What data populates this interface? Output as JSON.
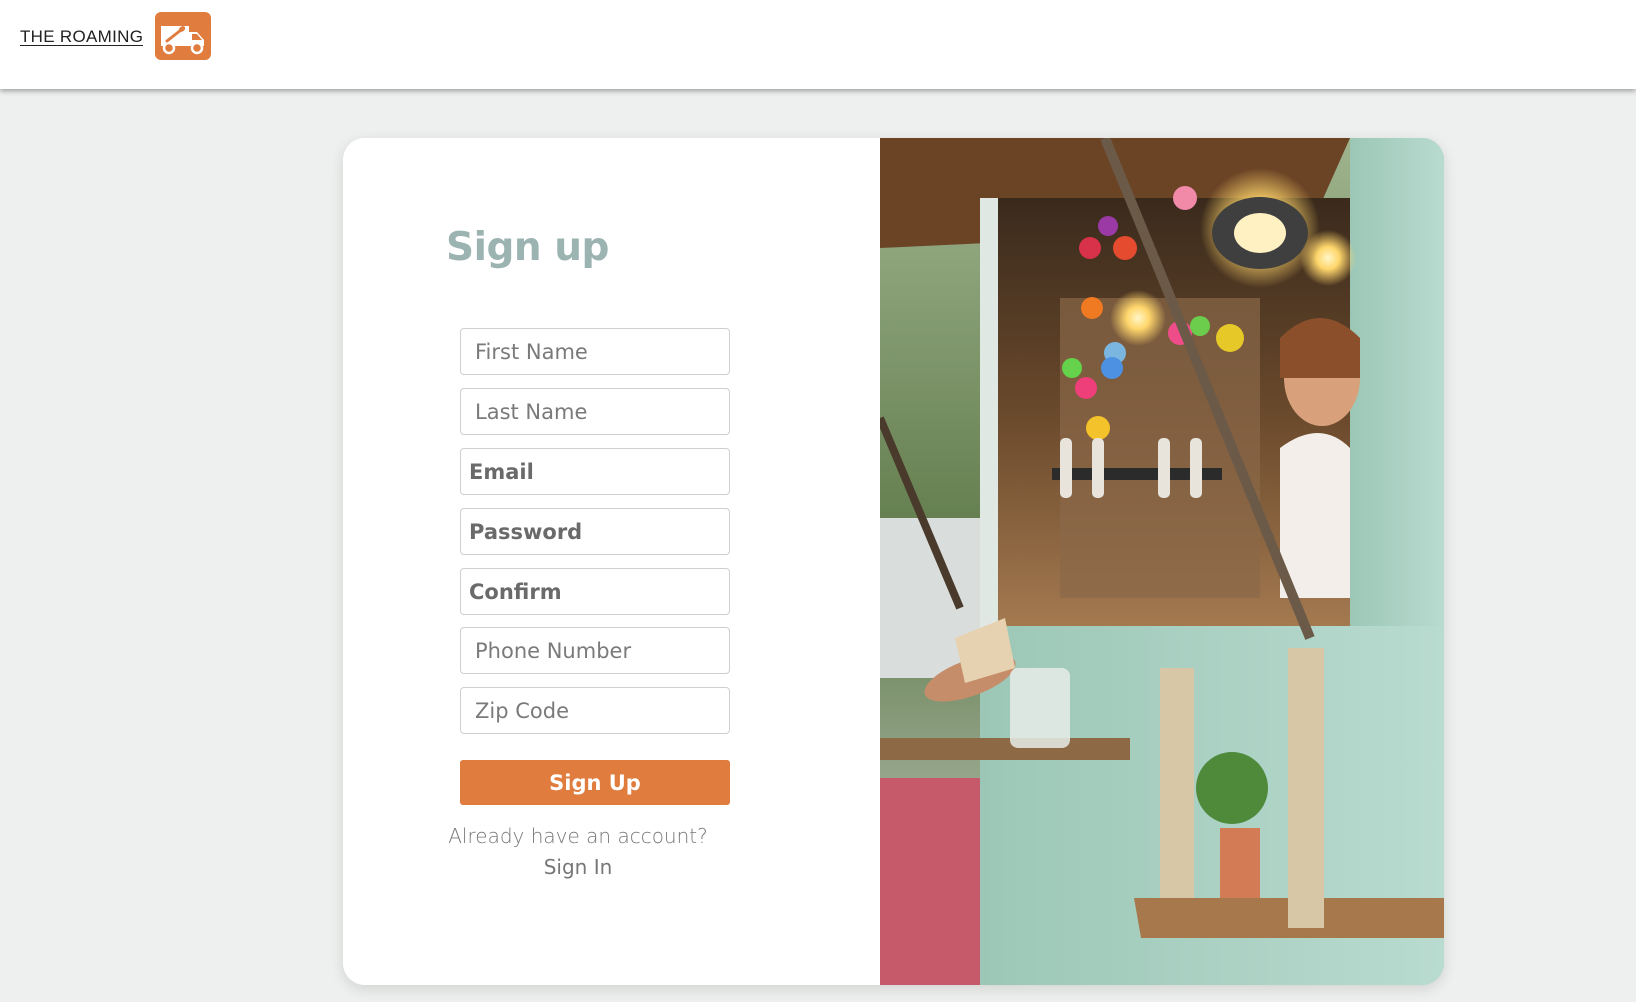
{
  "header": {
    "brand_name": "THE ROAMING",
    "logo_icon": "food-truck-icon",
    "accent_color": "#e07c3e"
  },
  "form": {
    "title": "Sign up",
    "fields": {
      "first_name": "First Name",
      "last_name": "Last Name",
      "email": "Email",
      "password": "Password",
      "confirm": "Confirm",
      "phone": "Phone Number",
      "zip": "Zip Code"
    },
    "submit_label": "Sign Up",
    "account_prompt": "Already have an account?",
    "signin_label": "Sign In"
  },
  "image": {
    "description_icon": "food-truck-photo"
  }
}
